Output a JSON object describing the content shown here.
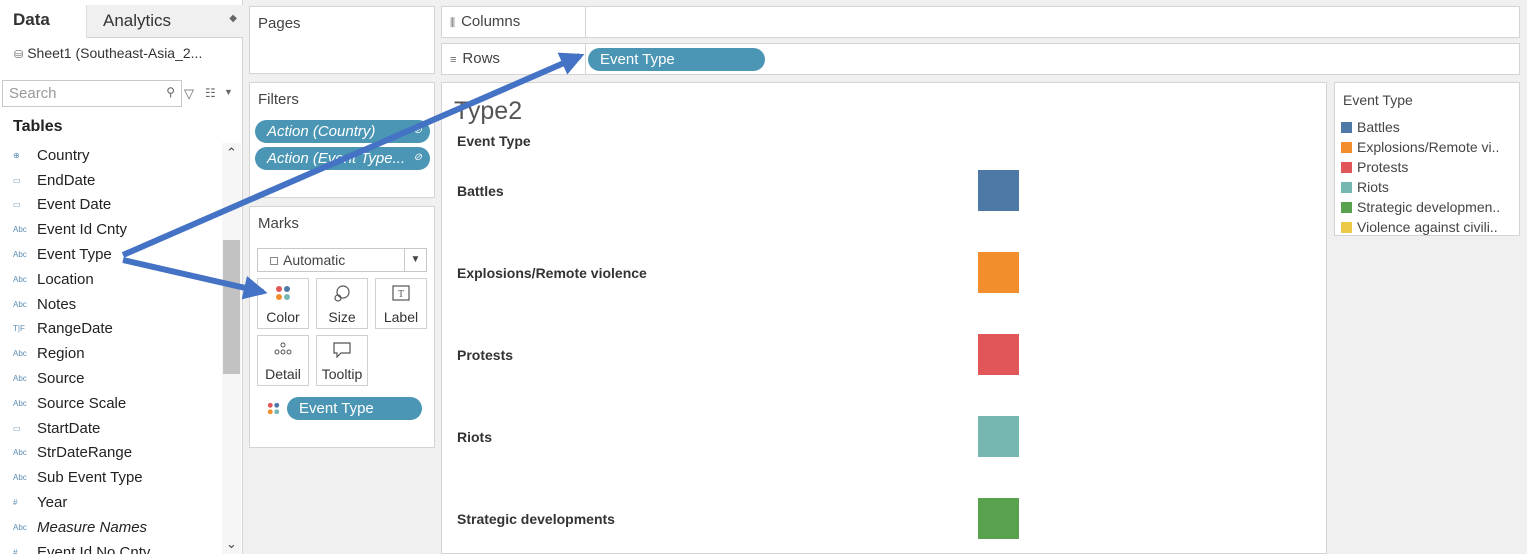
{
  "left_panel": {
    "tabs": {
      "data": "Data",
      "analytics": "Analytics"
    },
    "source": "Sheet1 (Southeast-Asia_2...",
    "search_placeholder": "Search",
    "tables_title": "Tables",
    "fields": [
      {
        "icon": "globe",
        "glyph": "⊕",
        "label": "Country",
        "italic": false
      },
      {
        "icon": "date",
        "glyph": "▭",
        "label": "EndDate",
        "italic": false
      },
      {
        "icon": "date",
        "glyph": "▭",
        "label": "Event Date",
        "italic": false
      },
      {
        "icon": "string",
        "glyph": "Abc",
        "label": "Event Id Cnty",
        "italic": false
      },
      {
        "icon": "string",
        "glyph": "Abc",
        "label": "Event Type",
        "italic": false
      },
      {
        "icon": "string",
        "glyph": "Abc",
        "label": "Location",
        "italic": false
      },
      {
        "icon": "string",
        "glyph": "Abc",
        "label": "Notes",
        "italic": false
      },
      {
        "icon": "boolean",
        "glyph": "T|F",
        "label": "RangeDate",
        "italic": false
      },
      {
        "icon": "string",
        "glyph": "Abc",
        "label": "Region",
        "italic": false
      },
      {
        "icon": "string",
        "glyph": "Abc",
        "label": "Source",
        "italic": false
      },
      {
        "icon": "string",
        "glyph": "Abc",
        "label": "Source Scale",
        "italic": false
      },
      {
        "icon": "date",
        "glyph": "▭",
        "label": "StartDate",
        "italic": false
      },
      {
        "icon": "string",
        "glyph": "Abc",
        "label": "StrDateRange",
        "italic": false
      },
      {
        "icon": "string",
        "glyph": "Abc",
        "label": "Sub Event Type",
        "italic": false
      },
      {
        "icon": "number",
        "glyph": "#",
        "label": "Year",
        "italic": false
      },
      {
        "icon": "string",
        "glyph": "Abc",
        "label": "Measure Names",
        "italic": true
      },
      {
        "icon": "number",
        "glyph": "#",
        "label": "Event Id No Cnty",
        "italic": false
      }
    ]
  },
  "pages": {
    "title": "Pages"
  },
  "filters": {
    "title": "Filters",
    "pills": [
      "Action (Country)",
      "Action (Event Type..."
    ]
  },
  "marks": {
    "title": "Marks",
    "type": "Automatic",
    "buttons": {
      "color": "Color",
      "size": "Size",
      "label": "Label",
      "detail": "Detail",
      "tooltip": "Tooltip"
    },
    "color_pill": "Event Type"
  },
  "columns": {
    "label": "Columns"
  },
  "rows": {
    "label": "Rows",
    "pill": "Event Type"
  },
  "view": {
    "title": "Type2",
    "column_header": "Event Type",
    "rows": [
      {
        "label": "Battles",
        "color": "#4e79a7"
      },
      {
        "label": "Explosions/Remote violence",
        "color": "#f28e2b"
      },
      {
        "label": "Protests",
        "color": "#e15759"
      },
      {
        "label": "Riots",
        "color": "#76b7b2"
      },
      {
        "label": "Strategic developments",
        "color": "#59a14f"
      }
    ]
  },
  "legend": {
    "title": "Event Type",
    "items": [
      {
        "label": "Battles",
        "color": "#4e79a7"
      },
      {
        "label": "Explosions/Remote vi..",
        "color": "#f28e2b"
      },
      {
        "label": "Protests",
        "color": "#e15759"
      },
      {
        "label": "Riots",
        "color": "#76b7b2"
      },
      {
        "label": "Strategic developmen..",
        "color": "#59a14f"
      },
      {
        "label": "Violence against civili..",
        "color": "#edc948"
      }
    ]
  },
  "annotation_arrow_color": "#4472c4"
}
